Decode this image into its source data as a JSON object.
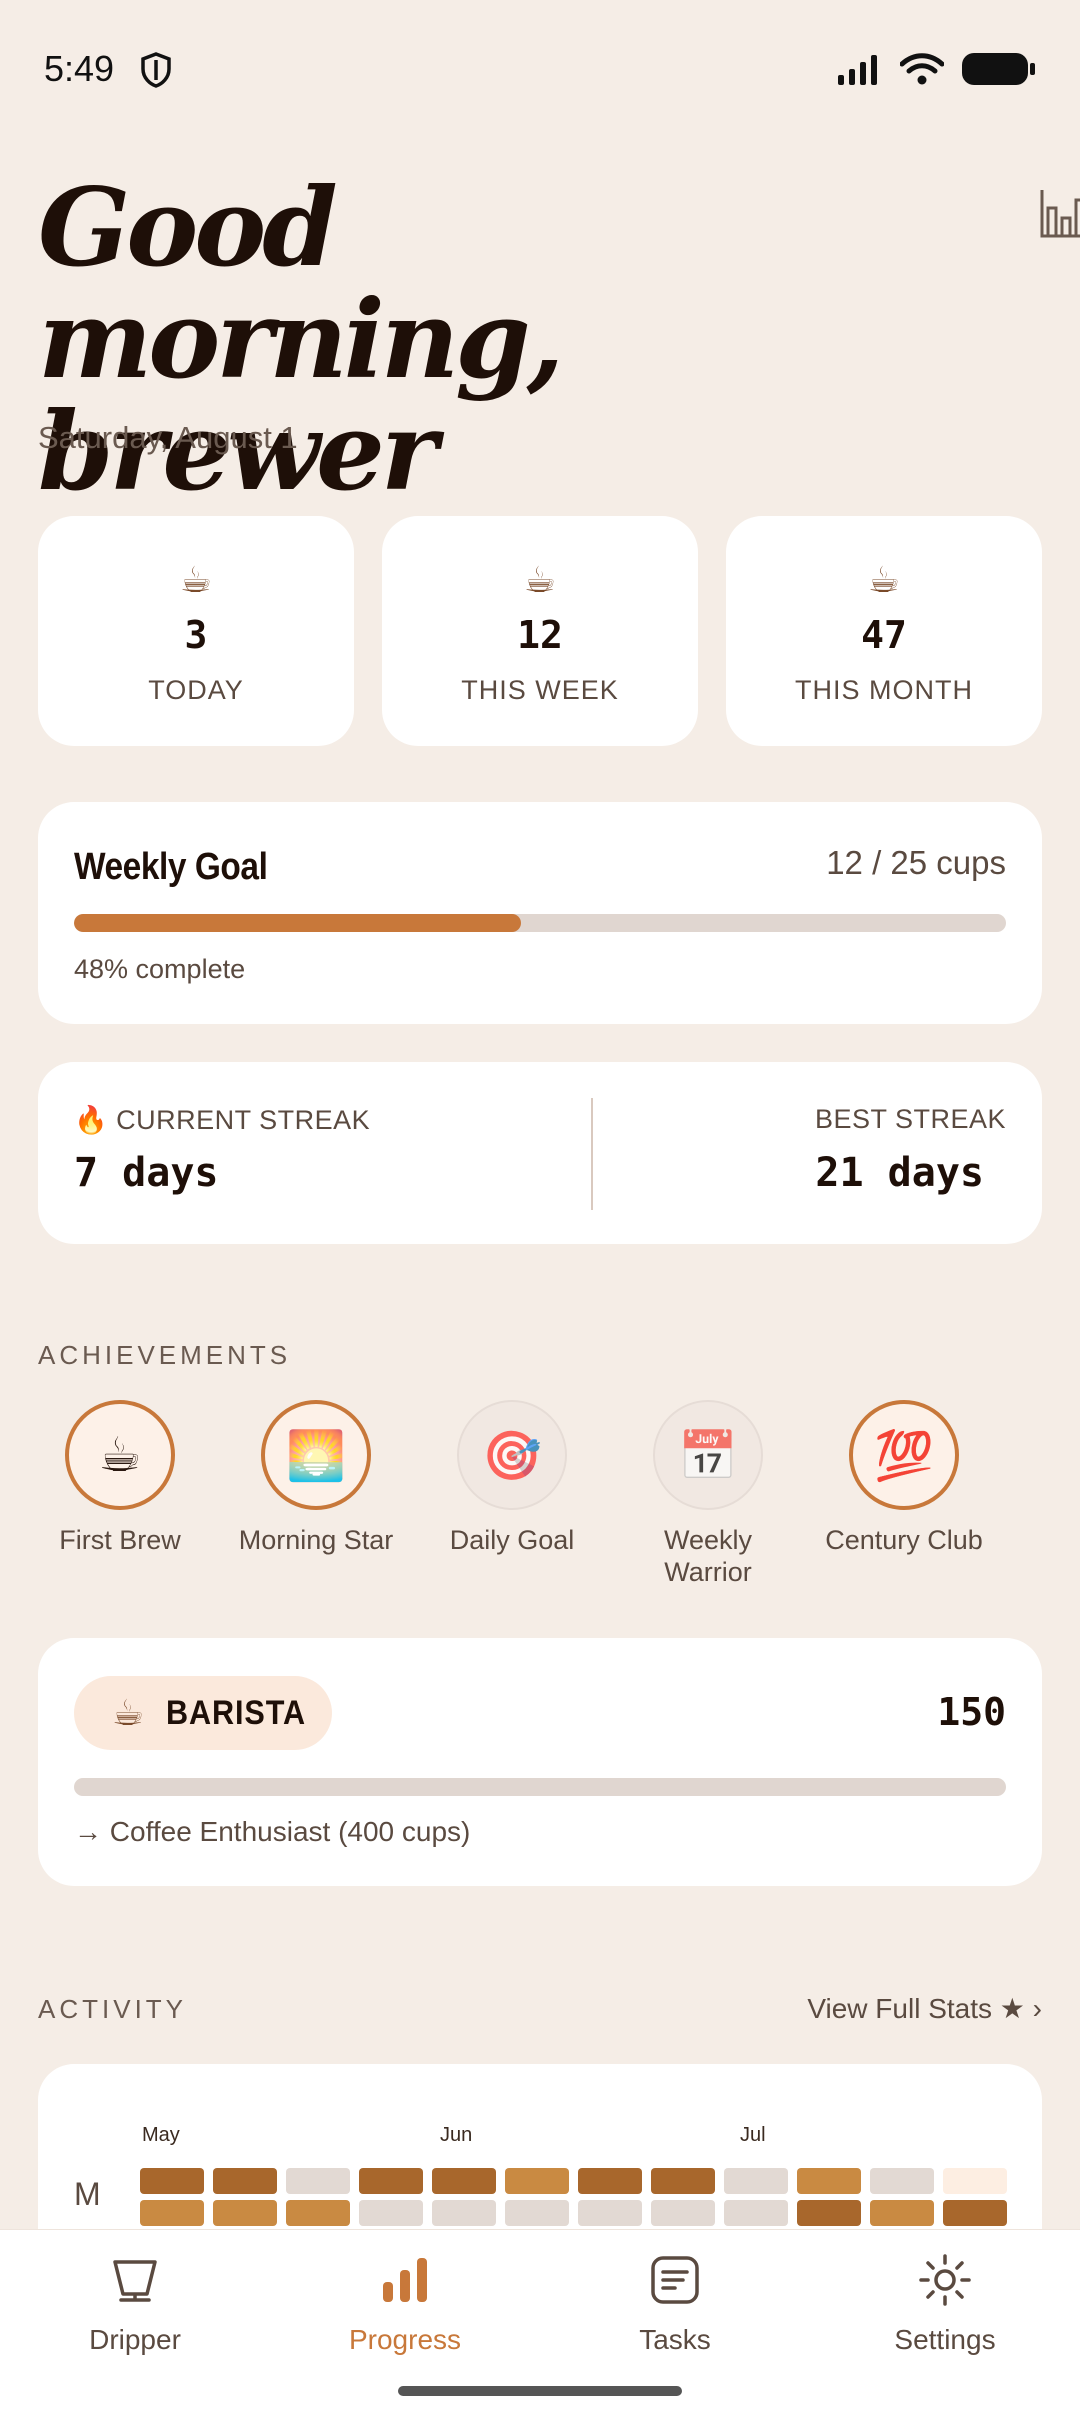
{
  "status_bar": {
    "time": "5:49"
  },
  "header": {
    "greeting": "Good morning, brewer",
    "date": "Saturday, August 1"
  },
  "stats": [
    {
      "icon": "☕",
      "value": "3",
      "label": "TODAY"
    },
    {
      "icon": "☕",
      "value": "12",
      "label": "THIS WEEK"
    },
    {
      "icon": "☕",
      "value": "47",
      "label": "THIS MONTH"
    }
  ],
  "weekly_goal": {
    "title": "Weekly Goal",
    "count": "12 / 25 cups",
    "percent_text": "48% complete",
    "progress_fraction": 0.48
  },
  "streaks": {
    "current_label": "CURRENT STREAK",
    "current_icon": "🔥",
    "current_value": "7 days",
    "best_label": "BEST STREAK",
    "best_value": "21 days"
  },
  "achievements": {
    "label": "ACHIEVEMENTS",
    "items": [
      {
        "icon": "☕",
        "name": "First Brew",
        "earned": true
      },
      {
        "icon": "🌅",
        "name": "Morning Star",
        "earned": true
      },
      {
        "icon": "🎯",
        "name": "Daily Goal",
        "earned": false
      },
      {
        "icon": "📅",
        "name": "Weekly Warrior",
        "earned": false
      },
      {
        "icon": "💯",
        "name": "Century Club",
        "earned": true
      }
    ]
  },
  "rank": {
    "icon": "☕",
    "title": "BARISTA",
    "points": "150",
    "next": "→ Coffee Enthusiast (400 cups)",
    "progress_fraction": 0
  },
  "activity": {
    "label": "ACTIVITY",
    "view_full": "View Full Stats ★ ›",
    "months": [
      "May",
      "Jun",
      "Jul"
    ],
    "day_label": "M",
    "rows": [
      [
        "dark",
        "dark",
        "empty",
        "dark",
        "dark",
        "mid",
        "dark",
        "dark",
        "empty",
        "mid",
        "empty",
        "light"
      ],
      [
        "mid",
        "mid",
        "mid",
        "empty",
        "empty",
        "empty",
        "empty",
        "empty",
        "empty",
        "dark",
        "mid",
        "dark"
      ]
    ],
    "colors": {
      "dark": "#a8672c",
      "mid": "#c98a42",
      "empty": "#e2d9d3",
      "light": "#fdeee2"
    }
  },
  "nav": {
    "items": [
      {
        "label": "Dripper",
        "icon": "dripper-icon",
        "active": false
      },
      {
        "label": "Progress",
        "icon": "bar-chart-icon",
        "active": true
      },
      {
        "label": "Tasks",
        "icon": "tasks-icon",
        "active": false
      },
      {
        "label": "Settings",
        "icon": "gear-icon",
        "active": false
      }
    ]
  },
  "theme": {
    "accent": "#c8783a",
    "background": "#f5ede6",
    "card": "#ffffff"
  }
}
